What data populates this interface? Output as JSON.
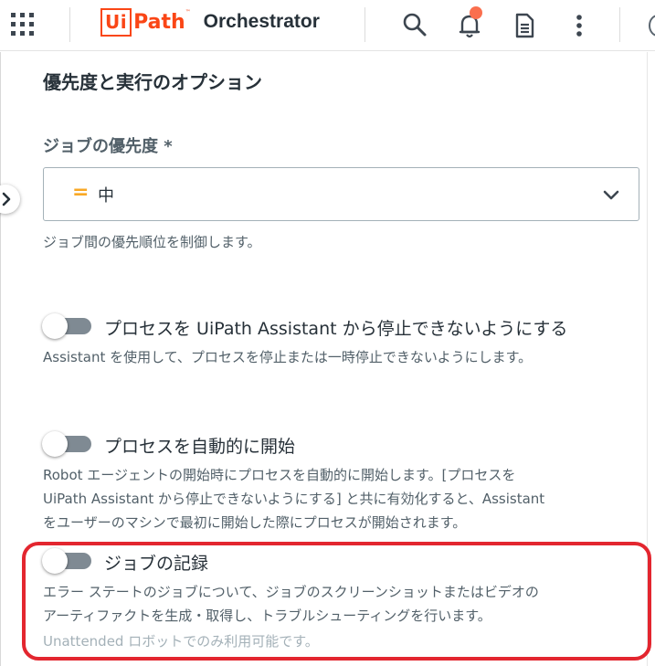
{
  "app": {
    "brand_box": "Ui",
    "brand_path": "Path",
    "brand_tm": "™",
    "product": "Orchestrator"
  },
  "icons": {
    "apps": "grid-icon",
    "search": "search-icon",
    "notifications": "bell-icon",
    "docs": "document-icon",
    "more": "more-vert-icon",
    "expand": "chevron-right-icon"
  },
  "colors": {
    "brand": "#fa4616",
    "notification_dot": "#fa6f4e",
    "priority_medium": "#f9a825",
    "highlight": "#e3262f"
  },
  "section": {
    "title": "優先度と実行のオプション"
  },
  "priority": {
    "label": "ジョブの優先度 *",
    "icon": "=",
    "value": "中",
    "helper": "ジョブ間の優先順位を制御します。"
  },
  "options": [
    {
      "label": "プロセスを UiPath Assistant から停止できないようにする",
      "enabled": false,
      "description": [
        "Assistant を使用して、プロセスを停止または一時停止できないようにします。"
      ]
    },
    {
      "label": "プロセスを自動的に開始",
      "enabled": false,
      "description": [
        "Robot エージェントの開始時にプロセスを自動的に開始します。[プロセスを",
        "UiPath Assistant から停止できないようにする] と共に有効化すると、Assistant",
        "をユーザーのマシンで最初に開始した際にプロセスが開始されます。"
      ]
    },
    {
      "label": "ジョブの記録",
      "enabled": false,
      "description": [
        "エラー ステートのジョブについて、ジョブのスクリーンショットまたはビデオの",
        "アーティファクトを生成・取得し、トラブルシューティングを行います。"
      ],
      "note": "Unattended ロボットでのみ利用可能です。"
    }
  ]
}
